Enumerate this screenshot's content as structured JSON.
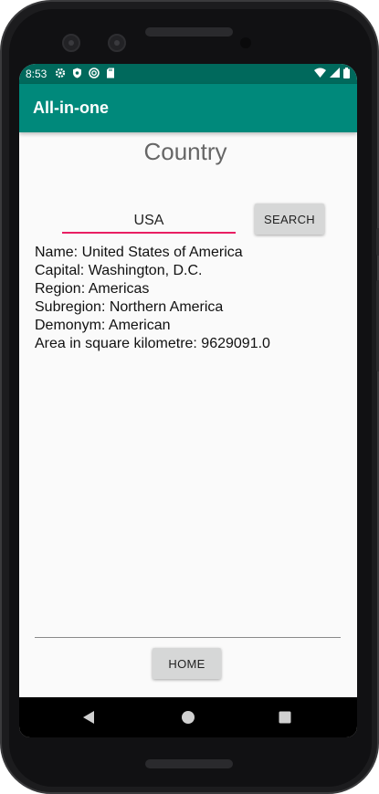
{
  "status_bar": {
    "time": "8:53",
    "left_icons": [
      "settings-icon",
      "shield-icon",
      "sync-icon",
      "sd-card-icon"
    ],
    "right_icons": [
      "wifi-icon",
      "signal-icon",
      "battery-icon"
    ]
  },
  "app_bar": {
    "title": "All-in-one",
    "color": "#00897b",
    "status_color": "#00695c"
  },
  "page": {
    "title": "Country"
  },
  "search": {
    "value": "USA",
    "button_label": "SEARCH",
    "underline_color": "#e91e63"
  },
  "result": {
    "lines": [
      "Name: United States of America",
      "Capital: Washington, D.C.",
      "Region: Americas",
      "Subregion: Northern America",
      "Demonym: American",
      "Area in square kilometre: 9629091.0"
    ]
  },
  "footer": {
    "home_label": "HOME"
  },
  "nav_bar": {
    "icons": [
      "back-icon",
      "home-icon",
      "recents-icon"
    ]
  }
}
